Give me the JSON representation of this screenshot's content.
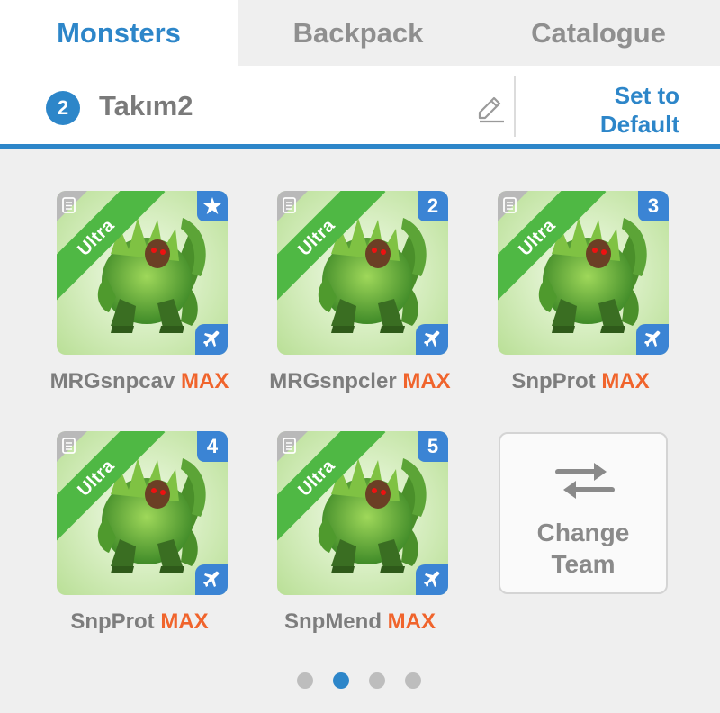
{
  "tabs": [
    {
      "label": "Monsters",
      "active": true
    },
    {
      "label": "Backpack",
      "active": false
    },
    {
      "label": "Catalogue",
      "active": false
    }
  ],
  "team": {
    "number": "2",
    "name": "Takım2",
    "set_default_line1": "Set to",
    "set_default_line2": "Default"
  },
  "monsters": [
    {
      "name": "MRGsnpcav",
      "level": "MAX",
      "rarity": "Ultra",
      "slot": "★",
      "icon": "star-icon"
    },
    {
      "name": "MRGsnpcler",
      "level": "MAX",
      "rarity": "Ultra",
      "slot": "2"
    },
    {
      "name": "SnpProt",
      "level": "MAX",
      "rarity": "Ultra",
      "slot": "3"
    },
    {
      "name": "SnpProt",
      "level": "MAX",
      "rarity": "Ultra",
      "slot": "4"
    },
    {
      "name": "SnpMend",
      "level": "MAX",
      "rarity": "Ultra",
      "slot": "5"
    }
  ],
  "change_team": {
    "line1": "Change",
    "line2": "Team"
  },
  "pager": {
    "total": 4,
    "active_index": 1
  },
  "colors": {
    "accent": "#2d86c9",
    "max": "#f0642c",
    "ultra_ribbon": "#4fb844",
    "slot_corner": "#3b84d4"
  }
}
